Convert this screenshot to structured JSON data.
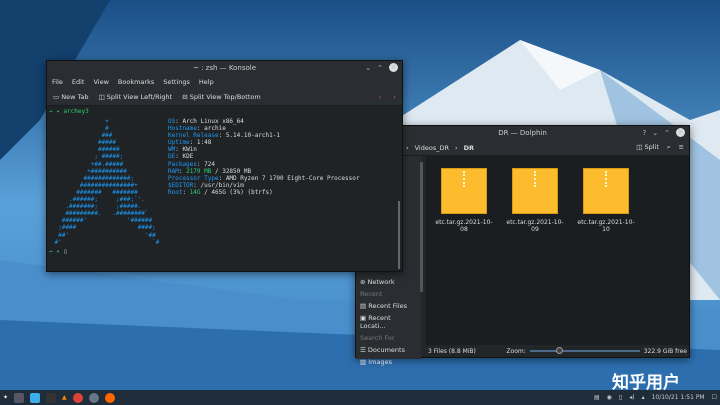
{
  "konsole": {
    "title": "~ : zsh — Konsole",
    "menu": [
      "File",
      "Edit",
      "View",
      "Bookmarks",
      "Settings",
      "Help"
    ],
    "toolbar": {
      "new_tab": "New Tab",
      "split_lr": "Split View Left/Right",
      "split_tb": "Split View Top/Bottom"
    },
    "prompt_dir": "archey3",
    "logo": "               +\n               #\n              ###\n             #####\n             ######\n            ; #####;\n           +##.#####\n          +##########\n         #############;\n        ###############+\n       #######   #######\n     .######;     ;###;`'.\n    .#######;     ;#####.\n    #########.   .########`\n   ######'           '######\n  ;####                 ####;\n  ##'                     '##\n #'                         `#",
    "info": [
      {
        "k": "OS",
        "v": "Arch Linux x86_64"
      },
      {
        "k": "Hostname",
        "v": "archie"
      },
      {
        "k": "Kernel Release",
        "v": "5.14.10-arch1-1"
      },
      {
        "k": "Uptime",
        "v": "1:48"
      },
      {
        "k": "WM",
        "v": "KWin"
      },
      {
        "k": "DE",
        "v": "KDE"
      },
      {
        "k": "Packages",
        "v": "724"
      },
      {
        "k": "RAM",
        "v1": "2179 MB",
        "v": " / 32850 MB"
      },
      {
        "k": "Processor Type",
        "v": "AMD Ryzen 7 1700 Eight-Core Processor"
      },
      {
        "k": "$EDITOR",
        "v": "/usr/bin/vim"
      },
      {
        "k": "Root",
        "v1": "14G",
        "v": " / 465G (3%) (btrfs)"
      }
    ]
  },
  "dolphin": {
    "title": "DR — Dolphin",
    "breadcrumb": [
      "Videos_DR",
      "DR"
    ],
    "split": "Split",
    "files": [
      "etc.tar.gz.2021-10-08",
      "etc.tar.gz.2021-10-09",
      "etc.tar.gz.2021-10-10"
    ],
    "sidebar": {
      "network": "Network",
      "recent_hdr": "Recent",
      "recent_files": "Recent Files",
      "recent_locations": "Recent Locati...",
      "search_hdr": "Search For",
      "documents": "Documents",
      "images": "Images"
    },
    "status": {
      "count": "3 Files (8.8 MiB)",
      "zoom": "Zoom:",
      "free": "322.9 GiB free"
    }
  },
  "taskbar": {
    "clock": "10/10/21  1:51 PM"
  },
  "watermark": "知乎用户"
}
